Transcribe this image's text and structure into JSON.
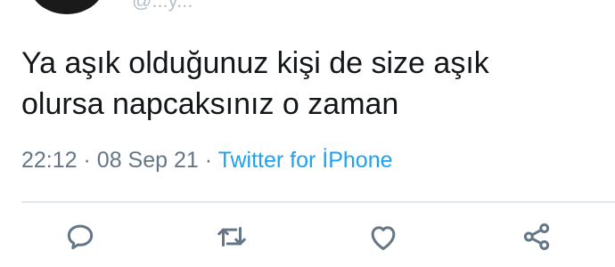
{
  "author": {
    "handle": "@...y...",
    "avatar_color": "#1a1a1a"
  },
  "tweet": {
    "text_line1": "Ya aşık olduğunuz kişi de size aşık",
    "text_line2": "olursa napcaksınız o zaman",
    "time": "22:12",
    "separator": "·",
    "date": "08 Sep 21",
    "source": "Twitter for İPhone"
  },
  "actions": [
    {
      "icon": "reply-icon"
    },
    {
      "icon": "retweet-icon"
    },
    {
      "icon": "like-icon"
    },
    {
      "icon": "share-icon"
    }
  ],
  "colors": {
    "text": "#14171a",
    "meta": "#657786",
    "link": "#1da1f2",
    "divider": "#e1e8ed"
  }
}
